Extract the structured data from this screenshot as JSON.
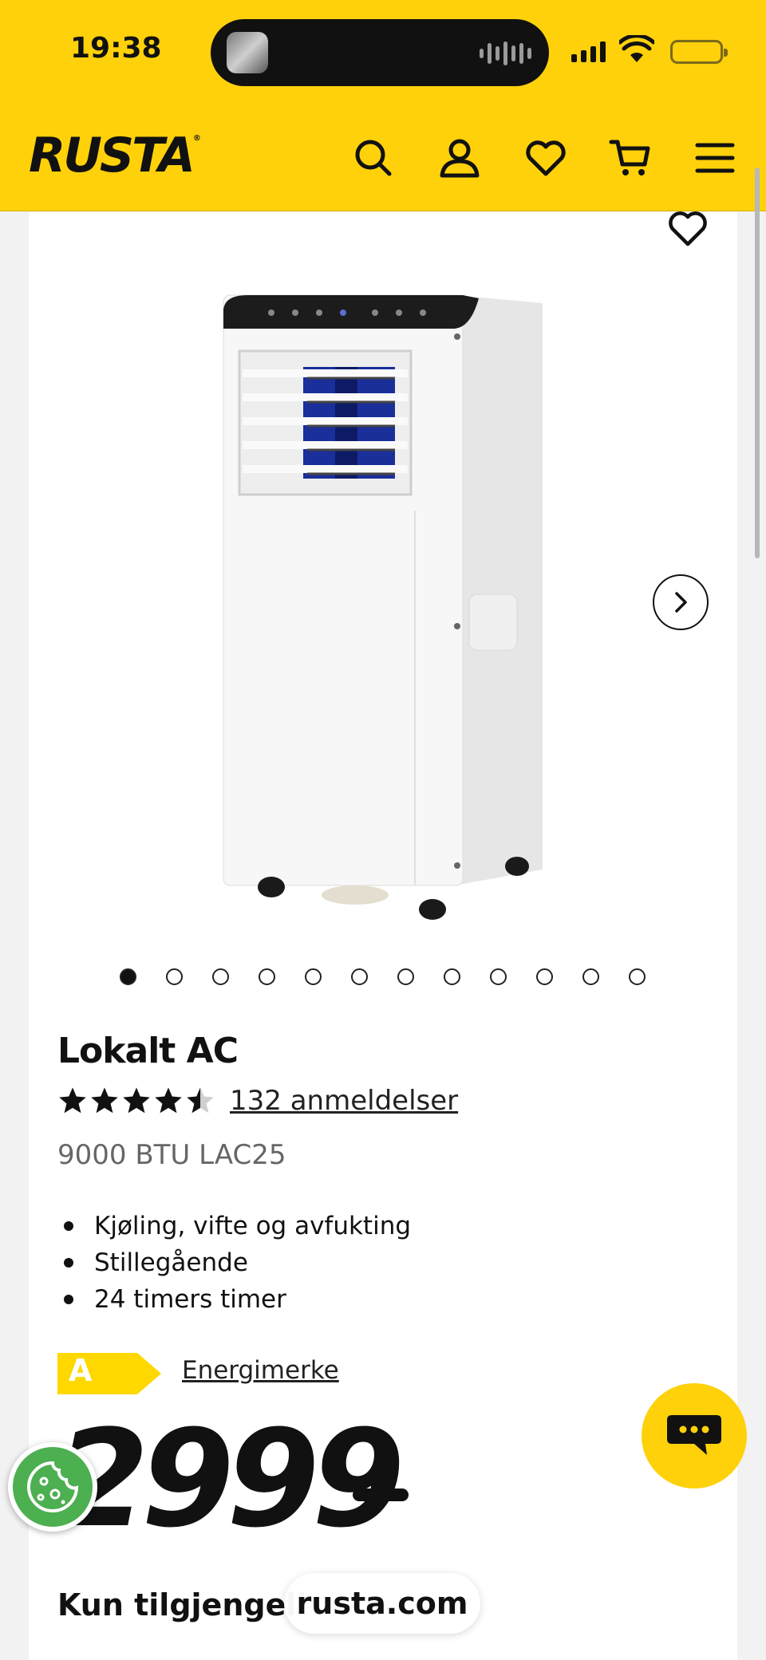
{
  "status_bar": {
    "time": "19:38"
  },
  "header": {
    "logo": "RUSTA",
    "icons": [
      "search-icon",
      "account-icon",
      "heart-icon",
      "cart-icon",
      "menu-icon"
    ],
    "brand_color": "#ffd10a"
  },
  "product": {
    "title": "Lokalt AC",
    "rating": 4.5,
    "reviews_label": "132 anmeldelser",
    "subtitle": "9000 BTU LAC25",
    "features": [
      "Kjøling, vifte og avfukting",
      "Stillegående",
      "24 timers timer"
    ],
    "energy_class": "A",
    "energy_link": "Energimerke",
    "price": "2999",
    "availability": "Kun tilgjengeli"
  },
  "gallery": {
    "total_images": 12,
    "active_index": 0
  },
  "browser": {
    "url": "rusta.com"
  }
}
